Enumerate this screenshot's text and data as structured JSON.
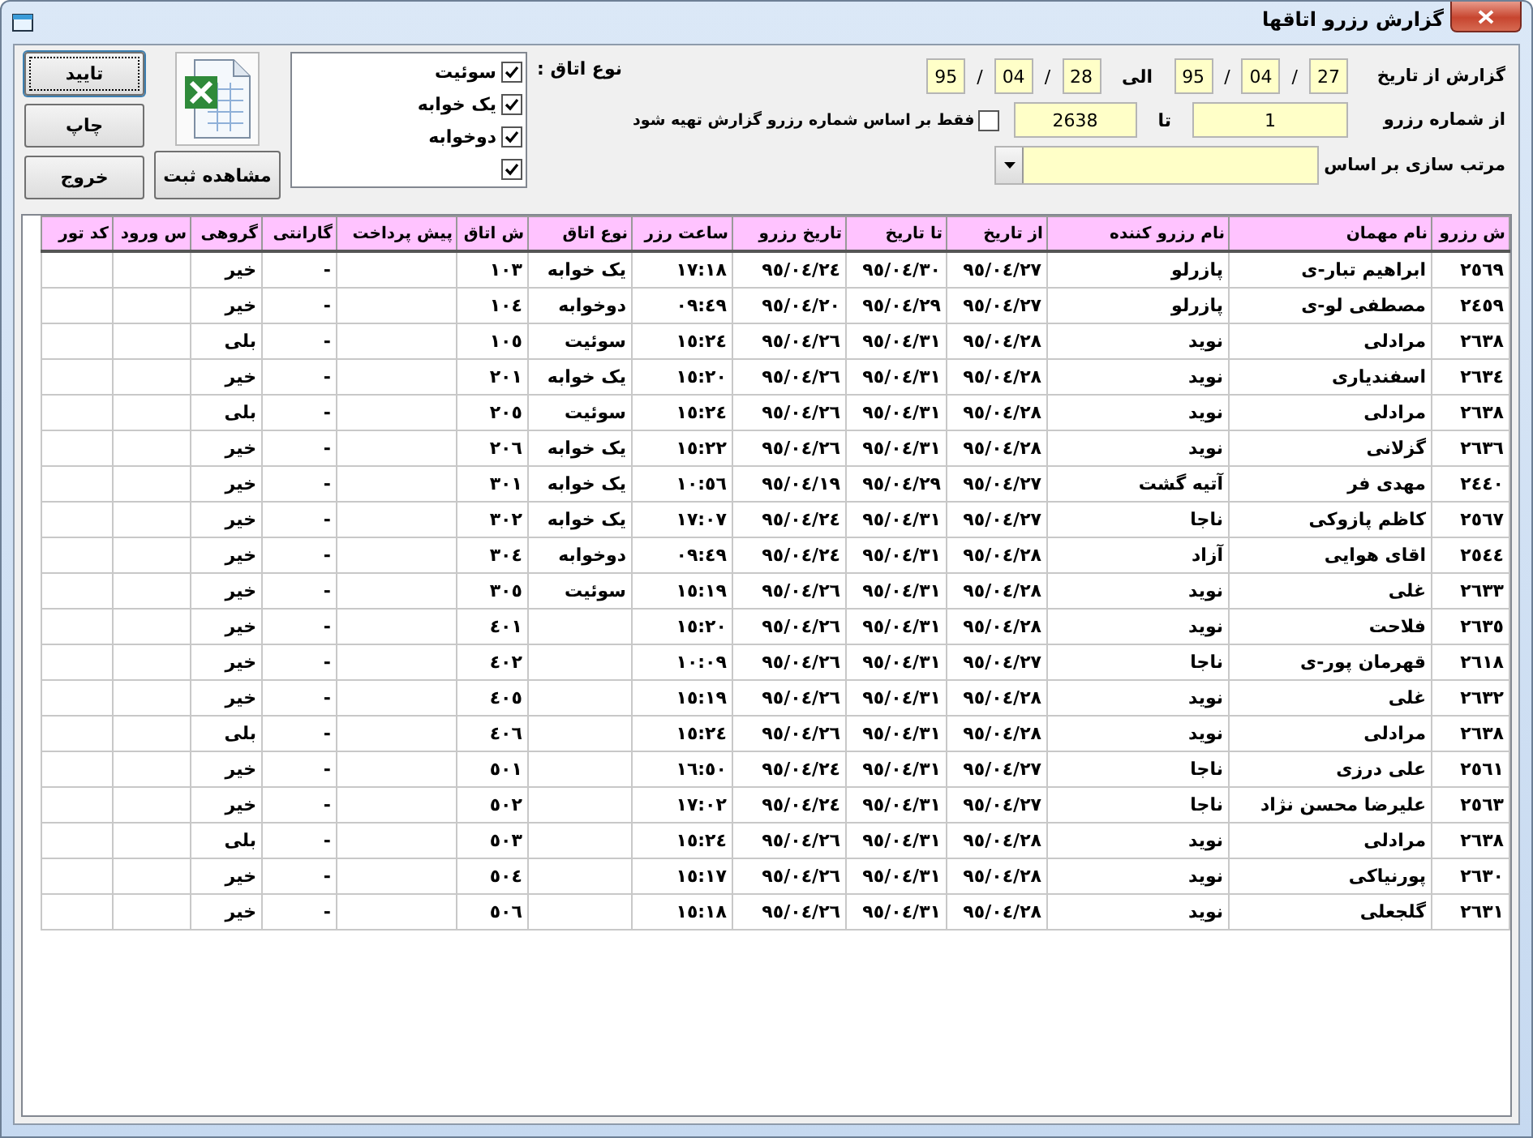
{
  "window": {
    "title": "گزارش رزرو اتاقها"
  },
  "buttons": [
    {
      "label": "تایید",
      "focused": true
    },
    {
      "label": "چاپ",
      "focused": false
    },
    {
      "label": "خروج",
      "focused": false
    }
  ],
  "export": {
    "label": "مشاهده ثبت"
  },
  "room_types": {
    "label": "نوع اتاق :",
    "items": [
      {
        "label": "سوئیت",
        "checked": true
      },
      {
        "label": "یک خوابه",
        "checked": true
      },
      {
        "label": "دوخوابه",
        "checked": true
      },
      {
        "checked": true
      }
    ]
  },
  "date_range": {
    "label": "گزارش از تاریخ",
    "from": [
      {
        "kind": "field",
        "value": "27"
      },
      {
        "kind": "separator",
        "value": "/"
      },
      {
        "kind": "field",
        "value": "04"
      },
      {
        "kind": "separator",
        "value": "/"
      },
      {
        "kind": "field",
        "value": "95"
      }
    ],
    "to_label": "الی",
    "to": [
      {
        "kind": "field",
        "value": "28"
      },
      {
        "kind": "separator",
        "value": "/"
      },
      {
        "kind": "field",
        "value": "04"
      },
      {
        "kind": "separator",
        "value": "/"
      },
      {
        "kind": "field",
        "value": "95"
      }
    ]
  },
  "reservation_range": {
    "label": "از شماره رزرو",
    "from": "1",
    "to_label": "تا",
    "to": "2638"
  },
  "only_by_number": {
    "label": "فقط بر اساس شماره رزرو گزارش تهیه شود",
    "checked": false
  },
  "sort": {
    "label": "مرتب سازی بر اساس"
  },
  "table": {
    "columns": [
      "ش رزرو",
      "نام مهمان",
      "نام رزرو کننده",
      "از تاریخ",
      "تا تاریخ",
      "تاریخ رزرو",
      "ساعت رزر",
      "نوع اتاق",
      "ش اتاق",
      "پیش پرداخت",
      "گارانتی",
      "گروهی",
      "س ورود",
      "کد تور"
    ],
    "rows": [
      [
        "٢٥٦٩",
        "ابراهیم تبار-ی",
        "پازرلو",
        "٩٥/٠٤/٢٧",
        "٩٥/٠٤/٣٠",
        "٩٥/٠٤/٢٤",
        "١٧:١٨",
        "یک خوابه",
        "١٠٣",
        null,
        "-",
        "خیر"
      ],
      [
        "٢٤٥٩",
        "مصطفی لو-ی",
        "پازرلو",
        "٩٥/٠٤/٢٧",
        "٩٥/٠٤/٢٩",
        "٩٥/٠٤/٢٠",
        "٠٩:٤٩",
        "دوخوابه",
        "١٠٤",
        null,
        "-",
        "خیر"
      ],
      [
        "٢٦٣٨",
        "مرادلی",
        "نوید",
        "٩٥/٠٤/٢٨",
        "٩٥/٠٤/٣١",
        "٩٥/٠٤/٢٦",
        "١٥:٢٤",
        "سوئیت",
        "١٠٥",
        null,
        "-",
        "بلی"
      ],
      [
        "٢٦٣٤",
        "اسفندیاری",
        "نوید",
        "٩٥/٠٤/٢٨",
        "٩٥/٠٤/٣١",
        "٩٥/٠٤/٢٦",
        "١٥:٢٠",
        "یک خوابه",
        "٢٠١",
        null,
        "-",
        "خیر"
      ],
      [
        "٢٦٣٨",
        "مرادلی",
        "نوید",
        "٩٥/٠٤/٢٨",
        "٩٥/٠٤/٣١",
        "٩٥/٠٤/٢٦",
        "١٥:٢٤",
        "سوئیت",
        "٢٠٥",
        null,
        "-",
        "بلی"
      ],
      [
        "٢٦٣٦",
        "گزلانی",
        "نوید",
        "٩٥/٠٤/٢٨",
        "٩٥/٠٤/٣١",
        "٩٥/٠٤/٢٦",
        "١٥:٢٢",
        "یک خوابه",
        "٢٠٦",
        null,
        "-",
        "خیر"
      ],
      [
        "٢٤٤٠",
        "مهدی فر",
        "آتیه گشت",
        "٩٥/٠٤/٢٧",
        "٩٥/٠٤/٢٩",
        "٩٥/٠٤/١٩",
        "١٠:٥٦",
        "یک خوابه",
        "٣٠١",
        null,
        "-",
        "خیر"
      ],
      [
        "٢٥٦٧",
        "کاظم پازوکی",
        "ناجا",
        "٩٥/٠٤/٢٧",
        "٩٥/٠٤/٣١",
        "٩٥/٠٤/٢٤",
        "١٧:٠٧",
        "یک خوابه",
        "٣٠٢",
        null,
        "-",
        "خیر"
      ],
      [
        "٢٥٤٤",
        "اقای هوایی",
        "آزاد",
        "٩٥/٠٤/٢٨",
        "٩٥/٠٤/٣١",
        "٩٥/٠٤/٢٤",
        "٠٩:٤٩",
        "دوخوابه",
        "٣٠٤",
        null,
        "-",
        "خیر"
      ],
      [
        "٢٦٣٣",
        "غلی",
        "نوید",
        "٩٥/٠٤/٢٨",
        "٩٥/٠٤/٣١",
        "٩٥/٠٤/٢٦",
        "١٥:١٩",
        "سوئیت",
        "٣٠٥",
        null,
        "-",
        "خیر"
      ],
      [
        "٢٦٣٥",
        "فلاحت",
        "نوید",
        "٩٥/٠٤/٢٨",
        "٩٥/٠٤/٣١",
        "٩٥/٠٤/٢٦",
        "١٥:٢٠",
        null,
        "٤٠١",
        null,
        "-",
        "خیر"
      ],
      [
        "٢٦١٨",
        "قهرمان پور-ی",
        "ناجا",
        "٩٥/٠٤/٢٧",
        "٩٥/٠٤/٣١",
        "٩٥/٠٤/٢٦",
        "١٠:٠٩",
        null,
        "٤٠٢",
        null,
        "-",
        "خیر"
      ],
      [
        "٢٦٣٢",
        "غلی",
        "نوید",
        "٩٥/٠٤/٢٨",
        "٩٥/٠٤/٣١",
        "٩٥/٠٤/٢٦",
        "١٥:١٩",
        null,
        "٤٠٥",
        null,
        "-",
        "خیر"
      ],
      [
        "٢٦٣٨",
        "مرادلی",
        "نوید",
        "٩٥/٠٤/٢٨",
        "٩٥/٠٤/٣١",
        "٩٥/٠٤/٢٦",
        "١٥:٢٤",
        null,
        "٤٠٦",
        null,
        "-",
        "بلی"
      ],
      [
        "٢٥٦١",
        "علی درزی",
        "ناجا",
        "٩٥/٠٤/٢٧",
        "٩٥/٠٤/٣١",
        "٩٥/٠٤/٢٤",
        "١٦:٥٠",
        null,
        "٥٠١",
        null,
        "-",
        "خیر"
      ],
      [
        "٢٥٦٣",
        "علیرضا محسن نژاد",
        "ناجا",
        "٩٥/٠٤/٢٧",
        "٩٥/٠٤/٣١",
        "٩٥/٠٤/٢٤",
        "١٧:٠٢",
        null,
        "٥٠٢",
        null,
        "-",
        "خیر"
      ],
      [
        "٢٦٣٨",
        "مرادلی",
        "نوید",
        "٩٥/٠٤/٢٨",
        "٩٥/٠٤/٣١",
        "٩٥/٠٤/٢٦",
        "١٥:٢٤",
        null,
        "٥٠٣",
        null,
        "-",
        "بلی"
      ],
      [
        "٢٦٣٠",
        "پورنیاکی",
        "نوید",
        "٩٥/٠٤/٢٨",
        "٩٥/٠٤/٣١",
        "٩٥/٠٤/٢٦",
        "١٥:١٧",
        null,
        "٥٠٤",
        null,
        "-",
        "خیر"
      ],
      [
        "٢٦٣١",
        "گلجعلی",
        "نوید",
        "٩٥/٠٤/٢٨",
        "٩٥/٠٤/٣١",
        "٩٥/٠٤/٢٦",
        "١٥:١٨",
        null,
        "٥٠٦",
        null,
        "-",
        "خیر"
      ]
    ]
  }
}
